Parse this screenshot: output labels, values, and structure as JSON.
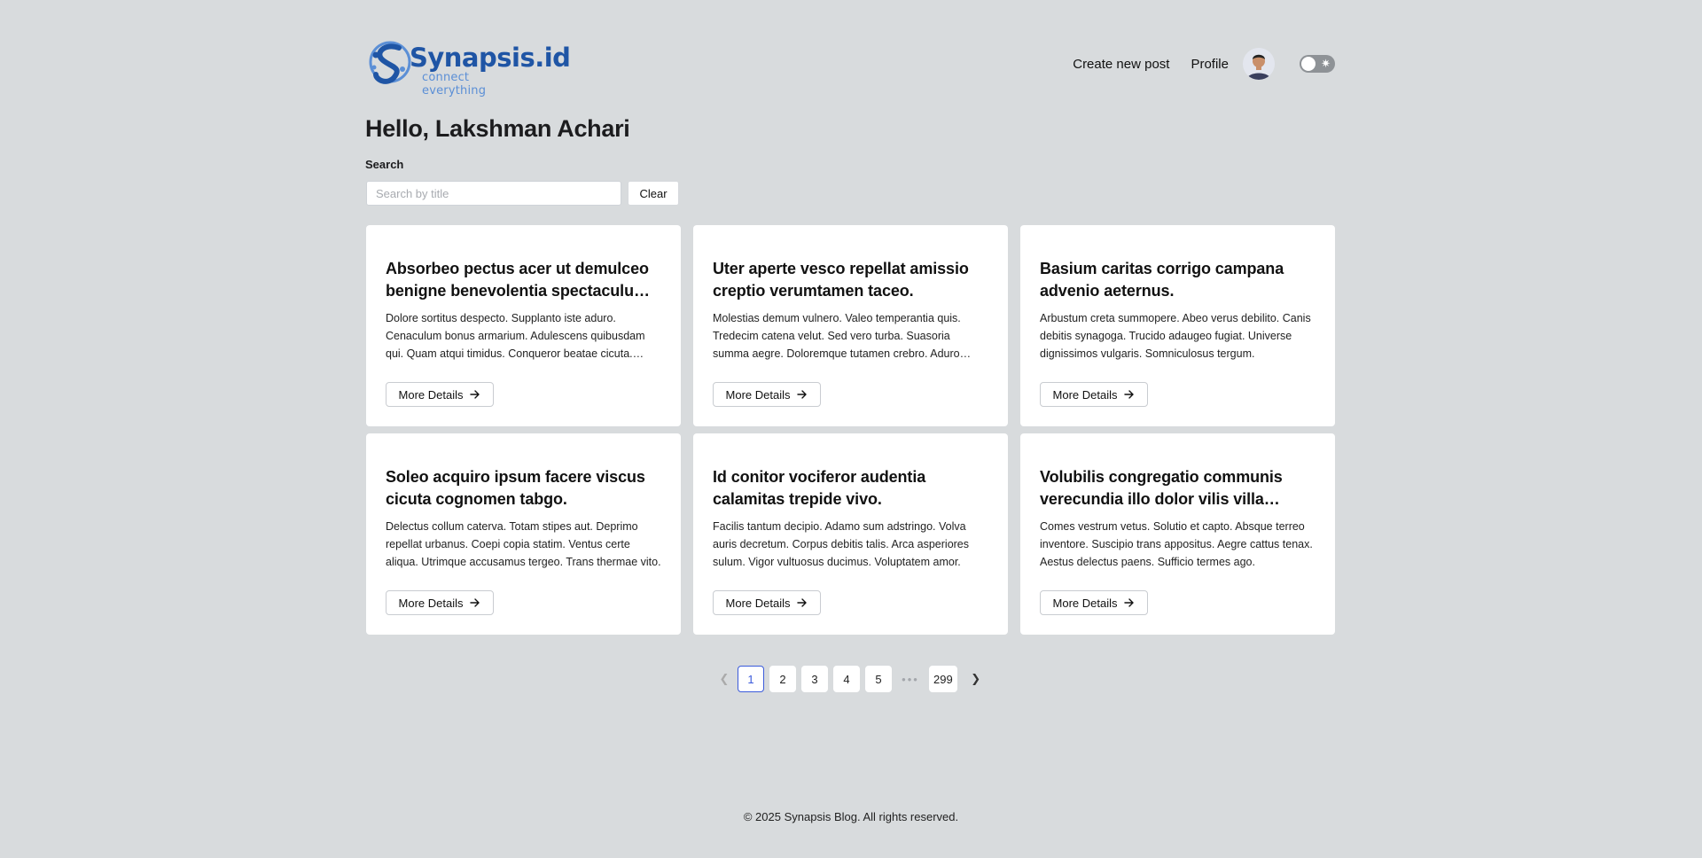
{
  "header": {
    "logo_name": "Synapsis.id",
    "logo_tagline": "connect everything",
    "nav_create": "Create new post",
    "nav_profile": "Profile",
    "theme_icon": "sun-icon"
  },
  "greeting": "Hello, Lakshman Achari",
  "search": {
    "label": "Search",
    "placeholder": "Search by title",
    "value": "",
    "clear_label": "Clear"
  },
  "posts": [
    {
      "title": "Absorbeo pectus acer ut demulceo benigne benevolentia spectaculum tamen.",
      "body": "Dolore sortitus despecto. Supplanto iste aduro. Cenaculum bonus armarium. Adulescens quibusdam qui. Quam atqui timidus. Conqueror beatae cicuta. Vesper sumo.",
      "button": "More Details"
    },
    {
      "title": "Uter aperte vesco repellat amissio creptio verumtamen taceo.",
      "body": "Molestias demum vulnero. Valeo temperantia quis. Tredecim catena velut. Sed vero turba. Suasoria summa aegre. Doloremque tutamen crebro. Aduro cena.",
      "button": "More Details"
    },
    {
      "title": "Basium caritas corrigo campana advenio aeternus.",
      "body": "Arbustum creta summopere. Abeo verus debilito. Canis debitis synagoga. Trucido adaugeo fugiat. Universe dignissimos vulgaris. Somniculosus tergum.",
      "button": "More Details"
    },
    {
      "title": "Soleo acquiro ipsum facere viscus cicuta cognomen tabgo.",
      "body": "Delectus collum caterva. Totam stipes aut. Deprimo repellat urbanus. Coepi copia statim. Ventus certe aliqua. Utrimque accusamus tergeo. Trans thermae vito.",
      "button": "More Details"
    },
    {
      "title": "Id conitor vociferor audentia calamitas trepide vivo.",
      "body": "Facilis tantum decipio. Adamo sum adstringo. Volva auris decretum. Corpus debitis talis. Arca asperiores sulum. Vigor vultuosus ducimus. Voluptatem amor.",
      "button": "More Details"
    },
    {
      "title": "Volubilis congregatio communis verecundia illo dolor vilis villa tenuis.",
      "body": "Comes vestrum vetus. Solutio et capto. Absque terreo inventore. Suscipio trans appositus. Aegre cattus tenax. Aestus delectus paens. Sufficio termes ago.",
      "button": "More Details"
    }
  ],
  "pagination": {
    "prev_icon": "chevron-left-icon",
    "next_icon": "chevron-right-icon",
    "pages": [
      "1",
      "2",
      "3",
      "4",
      "5"
    ],
    "current": "1",
    "ellipsis": "•••",
    "last": "299"
  },
  "footer": "© 2025 Synapsis Blog. All rights reserved."
}
